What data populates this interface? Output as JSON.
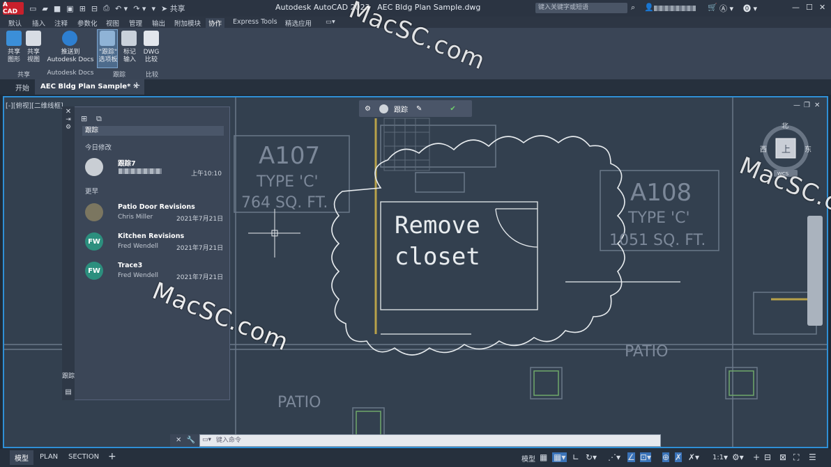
{
  "titlebar": {
    "logo": "A CAD",
    "share_label": "共享",
    "title": "Autodesk AutoCAD 2023",
    "filename": "AEC Bldg Plan Sample.dwg",
    "search_placeholder": "键入关键字或短语"
  },
  "menu": {
    "items": [
      {
        "label": "默认"
      },
      {
        "label": "插入"
      },
      {
        "label": "注释"
      },
      {
        "label": "参数化"
      },
      {
        "label": "视图"
      },
      {
        "label": "管理"
      },
      {
        "label": "输出"
      },
      {
        "label": "附加模块"
      },
      {
        "label": "协作"
      },
      {
        "label": "Express Tools"
      },
      {
        "label": "精选应用"
      }
    ]
  },
  "ribbon": {
    "share_drawing": "共享\n图形",
    "share_view": "共享\n视图",
    "push_docs_1": "推送到",
    "push_docs_2": "Autodesk Docs",
    "trace_palette": "\"跟踪\"\n选项板",
    "markup_import": "标记\n输入",
    "dwg_compare": "DWG\n比较",
    "group_share": "共享",
    "group_docs": "Autodesk Docs",
    "group_trace": "跟踪",
    "group_compare": "比较"
  },
  "tabs": {
    "start": "开始",
    "drawing": "AEC Bldg Plan Sample*"
  },
  "viewport": {
    "label": "[-][俯视][二维线框]"
  },
  "trace_toolbar": {
    "label": "跟踪"
  },
  "palette": {
    "header": "跟踪",
    "today_heading": "今日修改",
    "earlier_heading": "更早",
    "entries_today": [
      {
        "title": "跟踪7",
        "time": "上午10:10"
      }
    ],
    "entries_earlier": [
      {
        "title": "Patio Door Revisions",
        "author": "Chris Miller",
        "date": "2021年7月21日",
        "initials": ""
      },
      {
        "title": "Kitchen Revisions",
        "author": "Fred Wendell",
        "date": "2021年7月21日",
        "initials": "FW"
      },
      {
        "title": "Trace3",
        "author": "Fred Wendell",
        "date": "2021年7月21日",
        "initials": "FW"
      }
    ]
  },
  "drawing": {
    "room1_id": "A107",
    "room1_type": "TYPE 'C'",
    "room1_area": "764 SQ. FT.",
    "room2_id": "A108",
    "room2_type": "TYPE 'C'",
    "room2_area": "1051 SQ. FT.",
    "markup_line1": "Remove",
    "markup_line2": "closet",
    "patio1": "PATIO",
    "patio2": "PATIO"
  },
  "viewcube": {
    "north": "北",
    "east": "东",
    "top": "上",
    "west": "西",
    "wcs": "WCS"
  },
  "cmdline": {
    "placeholder": "键入命令"
  },
  "statusbar": {
    "tab_model": "模型",
    "tab_plan": "PLAN",
    "tab_section": "SECTION",
    "model_label": "模型",
    "scale": "1:1"
  },
  "watermark": "MacSC.com",
  "colors": {
    "accent": "#2f8fd6",
    "markup": "#e8ecef",
    "yellow_line": "#b8a24a",
    "green_line": "#6fa86a"
  }
}
